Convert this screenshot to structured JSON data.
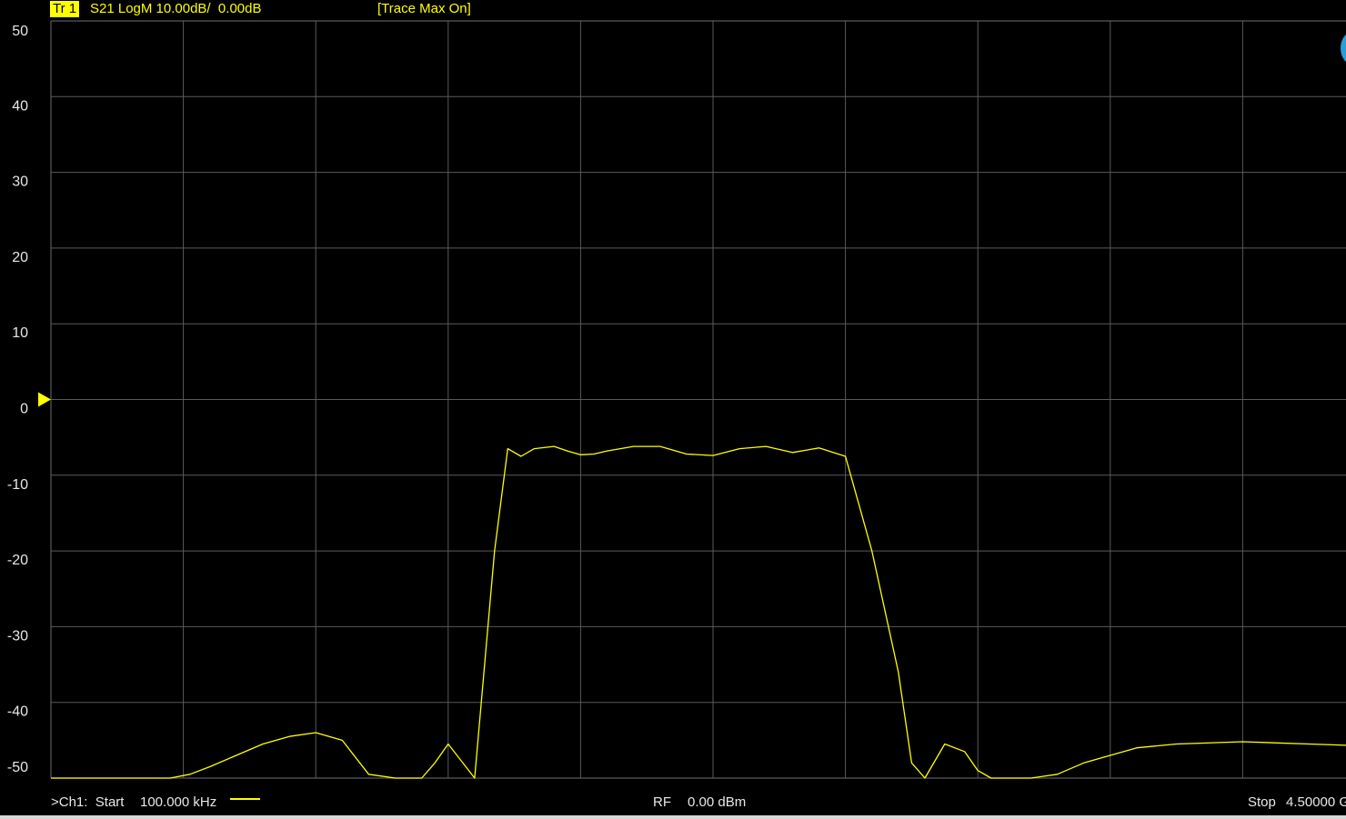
{
  "header": {
    "trace_tag": "Tr 1",
    "params": "S21 LogM 10.00dB/  0.00dB",
    "status": "[Trace Max On]"
  },
  "footer": {
    "start_label": ">Ch1:  Start",
    "start_value": "100.000 kHz",
    "rf_label": "RF",
    "rf_value": "0.00 dBm",
    "stop_label": "Stop",
    "stop_value": "4.50000 G"
  },
  "colors": {
    "background": "#000000",
    "grid": "#5a5a5a",
    "trace": "#ffff00",
    "axis_text": "#e6e6e6",
    "reference_marker": "#ffff00"
  },
  "chart_data": {
    "type": "line",
    "ylim": [
      -50,
      50
    ],
    "xlim": [
      0,
      10
    ],
    "grid": true,
    "reference_level": 0,
    "y_ticks": [
      "50",
      "40",
      "30",
      "20",
      "10",
      "0",
      "-10",
      "-20",
      "-30",
      "-40",
      "-50"
    ],
    "series": [
      {
        "x": [
          0,
          0.3,
          0.6,
          0.9,
          1.05,
          1.2,
          1.4,
          1.6,
          1.8,
          2.0,
          2.2,
          2.4,
          2.6,
          2.8,
          2.9,
          3.0,
          3.2,
          3.35,
          3.45,
          3.55,
          3.65,
          3.8,
          3.9,
          4.0,
          4.1,
          4.2,
          4.3,
          4.4,
          4.6,
          4.8,
          5.0,
          5.2,
          5.4,
          5.6,
          5.8,
          6.0,
          6.2,
          6.4,
          6.5,
          6.6,
          6.75,
          6.9,
          7.0,
          7.1,
          7.2,
          7.4,
          7.6,
          7.8,
          8.0,
          8.2,
          8.5,
          9.0,
          9.5,
          10.0
        ],
        "y": [
          -50,
          -50,
          -50,
          -50,
          -49.5,
          -48.5,
          -47,
          -45.5,
          -44.5,
          -44,
          -45,
          -49.5,
          -50,
          -50,
          -48,
          -45.5,
          -50,
          -20,
          -6.5,
          -7.5,
          -6.5,
          -6.2,
          -6.8,
          -7.3,
          -7.2,
          -6.8,
          -6.5,
          -6.2,
          -6.2,
          -7.2,
          -7.4,
          -6.5,
          -6.2,
          -7,
          -6.4,
          -7.5,
          -20,
          -36,
          -48,
          -50,
          -45.5,
          -46.5,
          -49,
          -50,
          -50,
          -50,
          -49.5,
          -48,
          -47,
          -46,
          -45.5,
          -45.2,
          -45.5,
          -45.8
        ]
      }
    ]
  }
}
